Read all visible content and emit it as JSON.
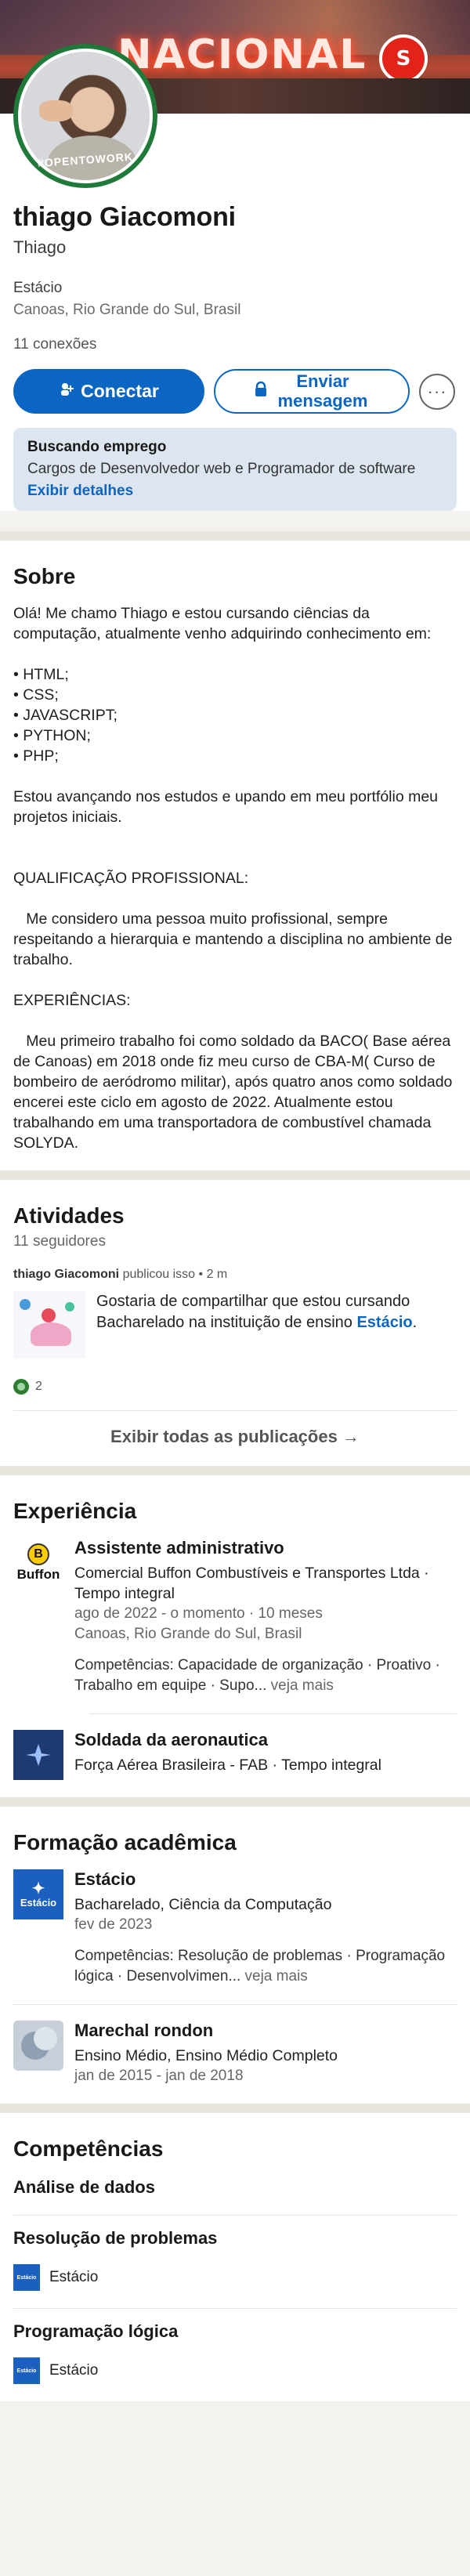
{
  "cover": {
    "sign_text": "NACIONAL",
    "emblem": "S"
  },
  "profile": {
    "badge": "#OPENTOWORK",
    "name": "thiago Giacomoni",
    "headline": "Thiago",
    "education": "Estácio",
    "location": "Canoas, Rio Grande do Sul, Brasil",
    "connections": "11 conexões",
    "connect_label": "Conectar",
    "message_label": "Enviar mensagem",
    "more_label": "···"
  },
  "job_search": {
    "title": "Buscando emprego",
    "roles": "Cargos de Desenvolvedor web e Programador de software",
    "link": "Exibir detalhes"
  },
  "about": {
    "title": "Sobre",
    "text": "Olá! Me chamo Thiago e estou cursando ciências da computação, atualmente venho adquirindo conhecimento em:\n\n• HTML;\n• CSS;\n• JAVASCRIPT;\n• PYTHON;\n• PHP;\n\nEstou avançando nos estudos e upando em meu portfólio meu projetos iniciais.\n\n\nQUALIFICAÇÃO PROFISSIONAL:\n\n   Me considero uma pessoa muito profissional, sempre respeitando a hierarquia e mantendo a disciplina no ambiente de trabalho.\n\nEXPERIÊNCIAS:\n\n   Meu primeiro trabalho foi como soldado da BACO( Base aérea de Canoas) em 2018 onde fiz meu curso de CBA-M( Curso de bombeiro de aeródromo militar), após quatro anos como soldado encerei este ciclo em agosto de 2022. Atualmente estou trabalhando em uma transportadora de combustível chamada SOLYDA."
  },
  "activity": {
    "title": "Atividades",
    "followers": "11 seguidores",
    "post_author": "thiago Giacomoni",
    "post_action": " publicou isso • 2 m",
    "post_text": "Gostaria de compartilhar que estou cursando Bacharelado na instituição de ensino ",
    "post_mention": "Estácio",
    "post_end": ".",
    "reactions": "2",
    "show_all": "Exibir todas as publicações →"
  },
  "experience": {
    "title": "Experiência",
    "items": [
      {
        "logo": "Buffon",
        "role": "Assistente administrativo",
        "company": "Comercial Buffon Combustíveis e Transportes Ltda · Tempo integral",
        "dates": "ago de 2022 - o momento · 10 meses",
        "location": "Canoas, Rio Grande do Sul, Brasil",
        "skills": "Competências: Capacidade de organização · Proativo · Trabalho em equipe · Supo...",
        "more": " veja mais"
      },
      {
        "role": "Soldada da aeronautica",
        "company": "Força Aérea Brasileira - FAB · Tempo integral"
      }
    ]
  },
  "education": {
    "title": "Formação acadêmica",
    "items": [
      {
        "logo": "Estácio",
        "school": "Estácio",
        "degree": "Bacharelado, Ciência da Computação",
        "dates": "fev de 2023",
        "skills": "Competências: Resolução de problemas · Programação lógica · Desenvolvimen...",
        "more": " veja mais"
      },
      {
        "school": "Marechal rondon",
        "degree": "Ensino Médio, Ensino Médio Completo",
        "dates": "jan de 2015 - jan de 2018"
      }
    ]
  },
  "skills": {
    "title": "Competências",
    "items": [
      {
        "name": "Análise de dados"
      },
      {
        "name": "Resolução de problemas",
        "source": "Estácio"
      },
      {
        "name": "Programação lógica",
        "source": "Estácio"
      }
    ],
    "source_logo": "Estácio"
  }
}
